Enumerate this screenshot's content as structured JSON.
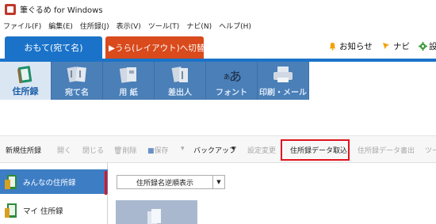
{
  "window": {
    "title": "筆ぐるめ for Windows"
  },
  "menu": [
    "ファイル(F)",
    "編集(E)",
    "住所録(J)",
    "表示(V)",
    "ツール(T)",
    "ナビ(N)",
    "ヘルプ(H)"
  ],
  "mode_tabs": {
    "front": "おもて(宛て名)",
    "back": "▶うら(レイアウト)へ切替"
  },
  "header_links": {
    "notice": "お知らせ",
    "navi": "ナビ",
    "settings": "設"
  },
  "ribbon": [
    {
      "label": "住所録",
      "icon": "address-book-icon",
      "active": true
    },
    {
      "label": "宛て名",
      "icon": "address-label-icon",
      "active": false
    },
    {
      "label": "用 紙",
      "icon": "paper-icon",
      "active": false
    },
    {
      "label": "差出人",
      "icon": "sender-icon",
      "active": false
    },
    {
      "label": "フォント",
      "icon": "font-icon",
      "active": false
    },
    {
      "label": "印刷・メール",
      "icon": "printer-icon",
      "active": false
    }
  ],
  "toolbar": {
    "new": "新規住所録",
    "open": "開く",
    "close": "閉じる",
    "delete": "削除",
    "save": "保存",
    "backup": "バックアップ",
    "settings_change": "設定変更",
    "import": "住所録データ取込",
    "export": "住所録データ書出",
    "more": "ツー"
  },
  "address_lists": [
    {
      "label": "みんなの住所録",
      "selected": true
    },
    {
      "label": "マイ 住所録",
      "selected": false
    }
  ],
  "sort": {
    "selected": "住所録名逆順表示"
  },
  "colors": {
    "front_tab": "#1a73c9",
    "back_tab": "#d94a1c",
    "ribbon": "#4a7fb8",
    "highlight": "#e0141e"
  }
}
